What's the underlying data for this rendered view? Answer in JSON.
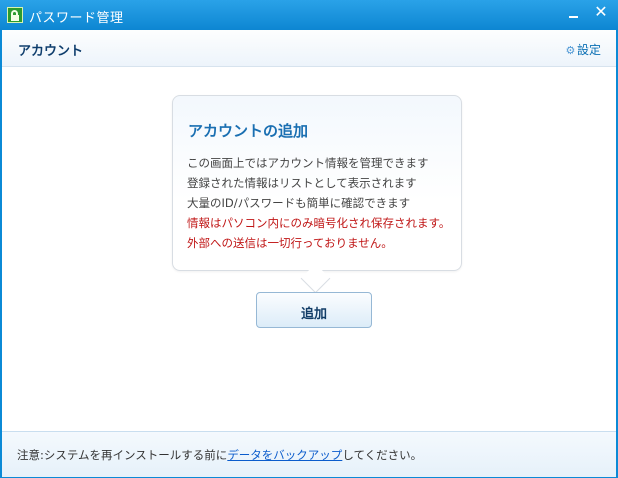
{
  "window": {
    "title": "パスワード管理",
    "close_glyph": "✕"
  },
  "subheader": {
    "title": "アカウント",
    "settings_label": "設定"
  },
  "popup": {
    "title": "アカウントの追加",
    "lines": [
      "この画面上ではアカウント情報を管理できます",
      "登録された情報はリストとして表示されます",
      "大量のID/パスワードも簡単に確認できます",
      "情報はパソコン内にのみ暗号化され保存されます。",
      "外部への送信は一切行っておりません。"
    ]
  },
  "add_button": {
    "label": "追加"
  },
  "footer": {
    "prefix": "注意:システムを再インストールする前に",
    "link": "データをバックアップ",
    "suffix": "してください。"
  },
  "colors": {
    "titlebar": "#1690d8",
    "warning_text": "#c01616",
    "accent": "#1a6fb2"
  }
}
